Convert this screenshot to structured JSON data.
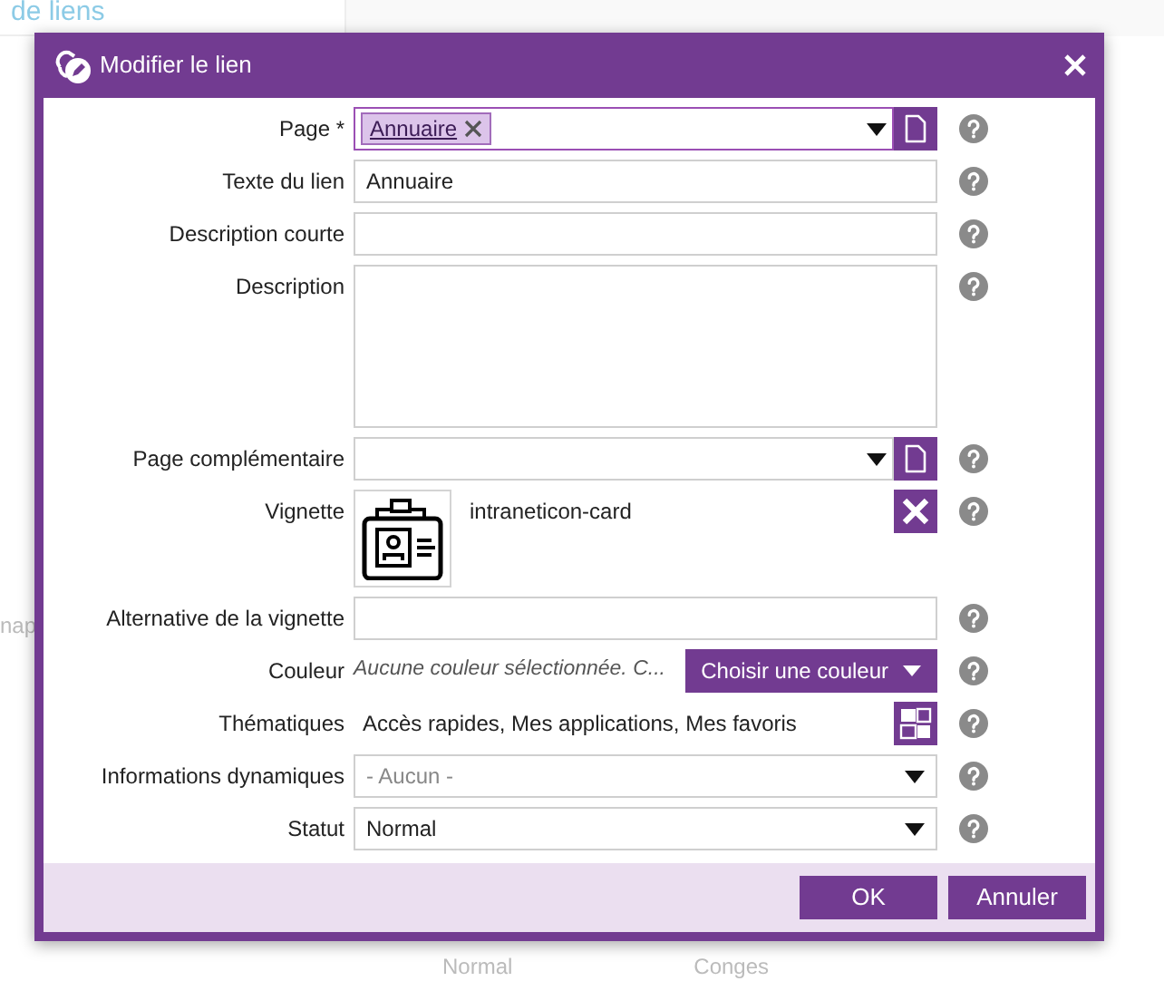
{
  "background": {
    "tab_label": "de liens",
    "side_text": "nap",
    "cells": [
      "Normal",
      "Conges"
    ]
  },
  "dialog": {
    "title": "Modifier le lien"
  },
  "fields": [
    {
      "kind": "tag-select",
      "label": "Page *",
      "tags": [
        "Annuaire"
      ],
      "focused": true
    },
    {
      "kind": "input",
      "label": "Texte du lien",
      "value": "Annuaire",
      "focused": false
    },
    {
      "kind": "input",
      "label": "Description courte",
      "focused": false
    },
    {
      "kind": "textarea",
      "label": "Description",
      "focused": false
    },
    {
      "kind": "tag-select",
      "label": "Page complémentaire",
      "focused": false
    },
    {
      "kind": "thumbnail",
      "label": "Vignette",
      "value": "intraneticon-card"
    },
    {
      "kind": "input",
      "label": "Alternative de la vignette",
      "focused": false
    },
    {
      "kind": "color",
      "label": "Couleur",
      "placeholder": "Aucune couleur sélectionnée. C...",
      "button": "Choisir une couleur"
    },
    {
      "kind": "themes",
      "label": "Thématiques",
      "value": "Accès rapides, Mes applications, Mes favoris"
    },
    {
      "kind": "select",
      "label": "Informations dynamiques",
      "placeholder": "- Aucun -"
    },
    {
      "kind": "select",
      "label": "Statut",
      "value": "Normal"
    }
  ],
  "buttons": [
    "OK",
    "Annuler"
  ]
}
